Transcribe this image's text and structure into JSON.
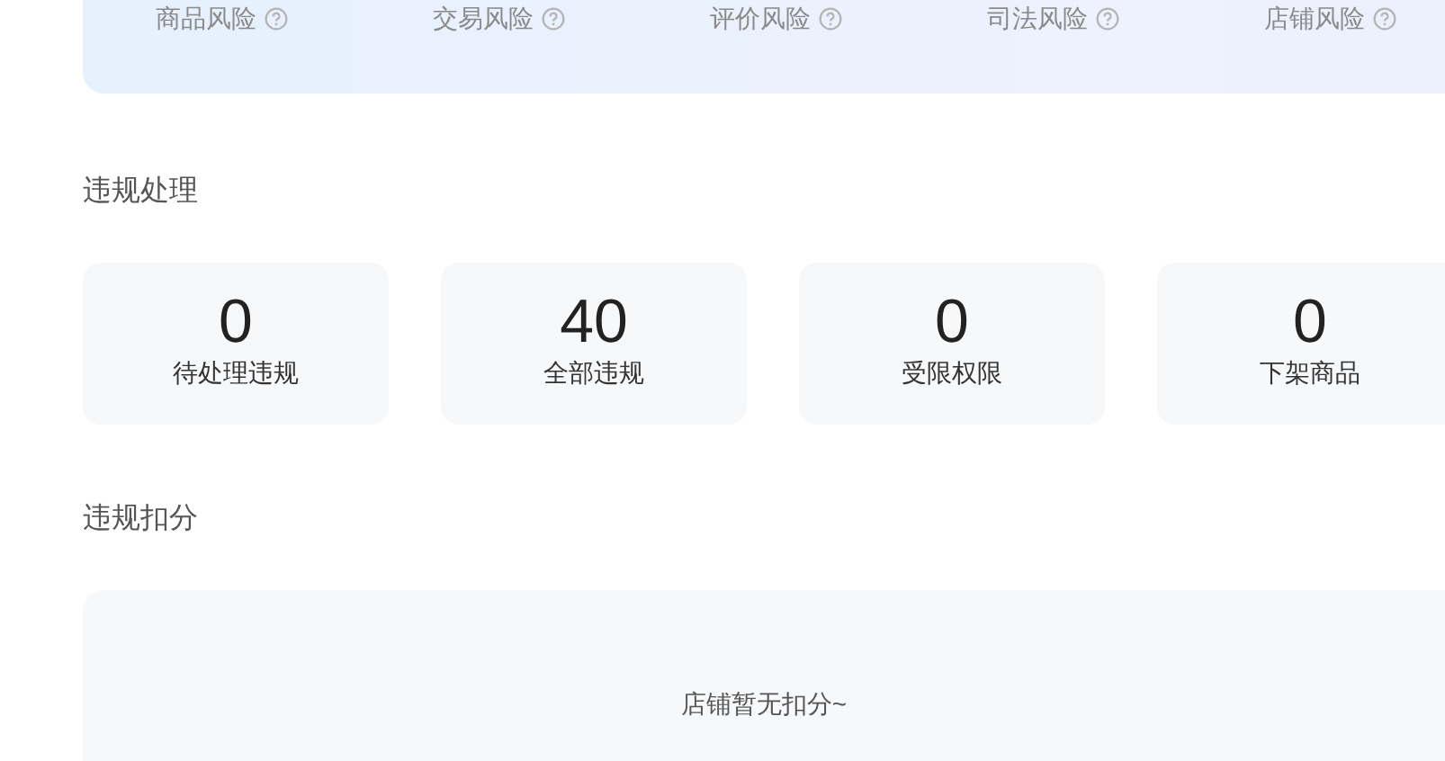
{
  "risk_tabs": [
    {
      "label": "商品风险"
    },
    {
      "label": "交易风险"
    },
    {
      "label": "评价风险"
    },
    {
      "label": "司法风险"
    },
    {
      "label": "店铺风险"
    }
  ],
  "violation_handling": {
    "title": "违规处理",
    "cards": [
      {
        "value": "0",
        "label": "待处理违规"
      },
      {
        "value": "40",
        "label": "全部违规"
      },
      {
        "value": "0",
        "label": "受限权限"
      },
      {
        "value": "0",
        "label": "下架商品"
      }
    ]
  },
  "violation_points": {
    "title": "违规扣分",
    "empty_text": "店铺暂无扣分~"
  }
}
